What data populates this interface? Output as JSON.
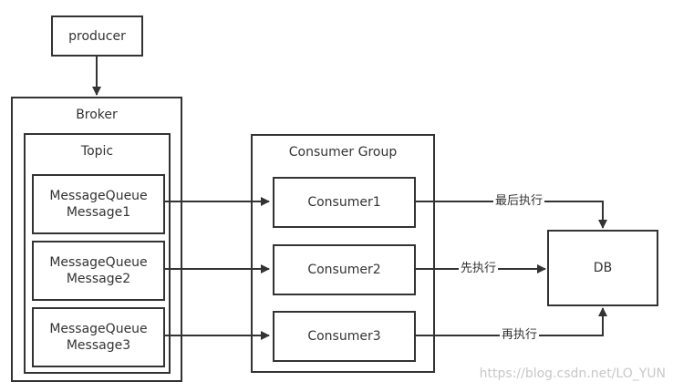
{
  "producer": {
    "label": "producer"
  },
  "broker": {
    "title": "Broker",
    "topic": {
      "title": "Topic",
      "queues": [
        {
          "name": "MessageQueue",
          "message": "Message1"
        },
        {
          "name": "MessageQueue",
          "message": "Message2"
        },
        {
          "name": "MessageQueue",
          "message": "Message3"
        }
      ]
    }
  },
  "consumer_group": {
    "title": "Consumer Group",
    "consumers": [
      {
        "label": "Consumer1"
      },
      {
        "label": "Consumer2"
      },
      {
        "label": "Consumer3"
      }
    ]
  },
  "db": {
    "label": "DB"
  },
  "edge_labels": {
    "first": "最后执行",
    "second": "先执行",
    "third": "再执行"
  },
  "watermark": "https://blog.csdn.net/LO_YUN",
  "colors": {
    "stroke": "#333333",
    "watermark": "#c8c8c8"
  }
}
